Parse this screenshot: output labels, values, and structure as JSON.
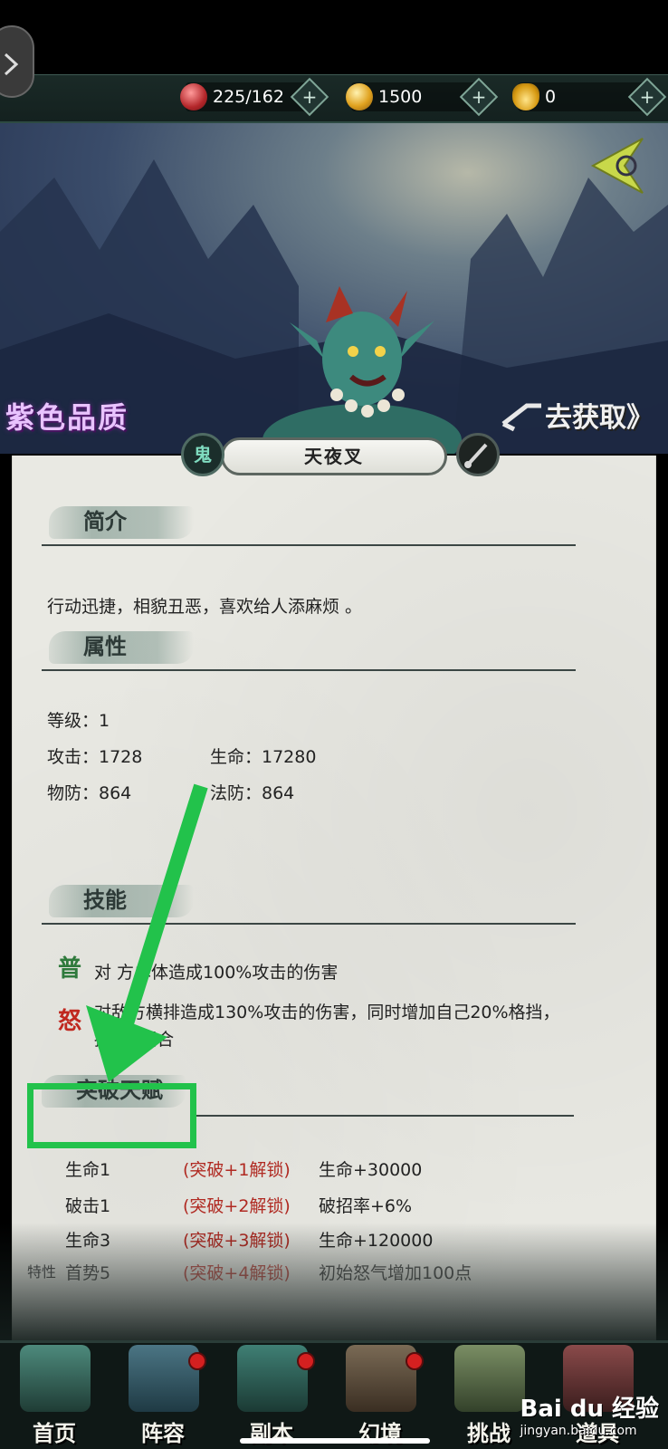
{
  "resources": [
    {
      "name": "stamina",
      "value": "225/162",
      "icon": "red-orb-icon",
      "plus": "+"
    },
    {
      "name": "coins",
      "value": "1500",
      "icon": "coin-icon",
      "plus": "+"
    },
    {
      "name": "ingots",
      "value": "0",
      "icon": "gold-ingot-icon",
      "plus": "+"
    }
  ],
  "hero": {
    "quality": "紫色品质",
    "obtain": "去获取",
    "obtain_arrow": "》",
    "name": "天夜叉",
    "type_badge": "鬼"
  },
  "sections": {
    "intro_title": "简介",
    "intro_text": "行动迅捷，相貌丑恶，喜欢给人添麻烦 。",
    "attr_title": "属性",
    "skill_title": "技能",
    "talent_title": "突破天赋"
  },
  "attributes": {
    "level": "等级：1",
    "attack": "攻击：1728",
    "hp": "生命：17280",
    "pdef": "物防：864",
    "mdef": "法防：864"
  },
  "skills": [
    {
      "icon_char": "普",
      "color": "#2f7a3c",
      "text": "对敌方单体造成100%攻击的伤害",
      "visible": "对  方单体造成100%攻击的伤害"
    },
    {
      "icon_char": "怒",
      "color": "#c0281f",
      "line1": "对敌方横排造成130%攻击的伤害，同时增加自己20%格挡，",
      "line2": "持续2回合"
    }
  ],
  "talents": [
    {
      "name": "生命1",
      "unlock": "(突破+1解锁)",
      "effect": "生命+30000"
    },
    {
      "name": "破击1",
      "unlock": "(突破+2解锁)",
      "effect": "破招率+6%"
    },
    {
      "name": "生命3",
      "unlock": "(突破+3解锁)",
      "effect": "生命+120000"
    },
    {
      "name": "首势5",
      "unlock": "(突破+4解锁)",
      "effect": "初始怒气增加100点"
    }
  ],
  "trait_label": "特性",
  "nav": [
    {
      "label": "首页",
      "art": "palace-icon",
      "color": "#3d6a5f",
      "dot": false
    },
    {
      "label": "阵容",
      "art": "scroll-book-icon",
      "color": "#3a5a66",
      "dot": true
    },
    {
      "label": "副本",
      "art": "sword-icon",
      "color": "#2f5f57",
      "dot": true
    },
    {
      "label": "幻境",
      "art": "crossed-swords-icon",
      "color": "#5a4a3a",
      "dot": true
    },
    {
      "label": "挑战",
      "art": "scroll-map-icon",
      "color": "#556b4a",
      "dot": false
    },
    {
      "label": "道具",
      "art": "treasure-icon",
      "color": "#6a3a3a",
      "dot": false
    }
  ],
  "watermark": {
    "brand": "Bai du 经验",
    "url": "jingyan.baidu.com"
  }
}
